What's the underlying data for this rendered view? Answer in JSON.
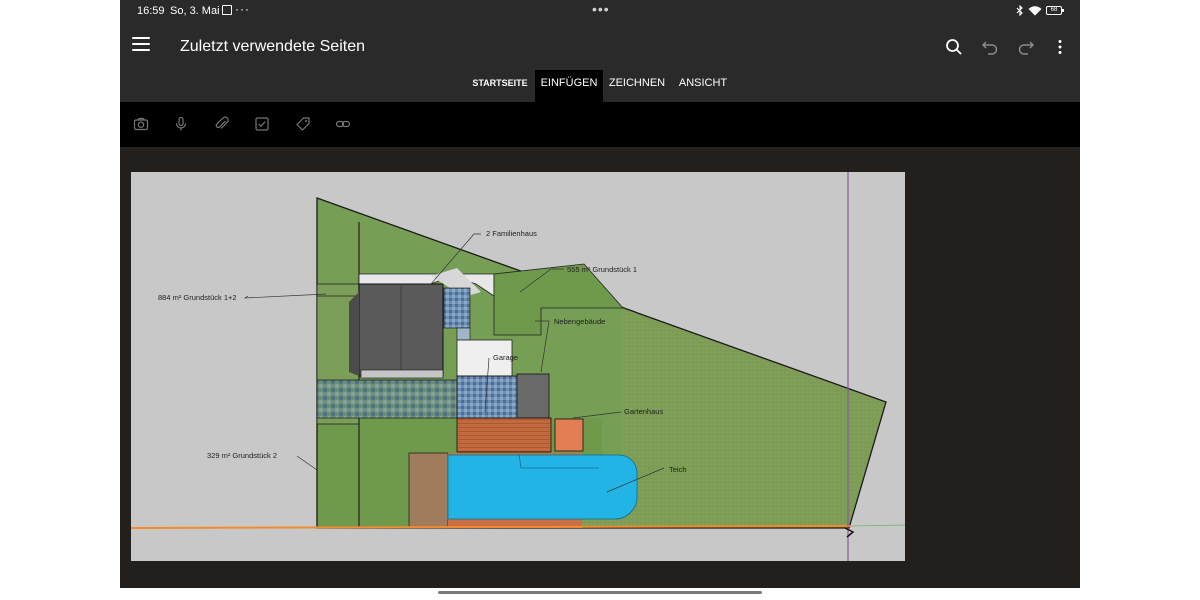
{
  "status": {
    "time": "16:59",
    "date": "So, 3. Mai",
    "more": "···",
    "battery": "68"
  },
  "header": {
    "title": "Zuletzt verwendete Seiten"
  },
  "tabs": [
    {
      "label": "STARTSEITE",
      "active": false
    },
    {
      "label": "EINFÜGEN",
      "active": true
    },
    {
      "label": "ZEICHNEN",
      "active": false
    },
    {
      "label": "ANSICHT",
      "active": false
    }
  ],
  "toolbar_icons": [
    "camera-icon",
    "microphone-icon",
    "attachment-icon",
    "checkbox-icon",
    "tag-icon",
    "link-icon"
  ],
  "header_icons": [
    "search-icon",
    "undo-icon",
    "redo-icon",
    "more-vert-icon"
  ],
  "plan": {
    "labels": {
      "familienhaus": "2 Familienhaus",
      "grundstueck1": "555 m² Grundstück 1",
      "grundstueck12": "884 m² Grundstück 1+2",
      "nebengebaeude": "Nebengebäude",
      "garage": "Garage",
      "gartenhaus": "Gartenhaus",
      "grundstueck2": "329 m² Grundstück 2",
      "teich": "Teich"
    }
  },
  "colors": {
    "bar": "#2a2a2a",
    "toolbar": "#000000",
    "canvas": "#231f1c",
    "lawn": "#6f9a4b",
    "pond": "#22b4e4",
    "roof": "#5a5a5a",
    "brick": "#c2693f"
  }
}
